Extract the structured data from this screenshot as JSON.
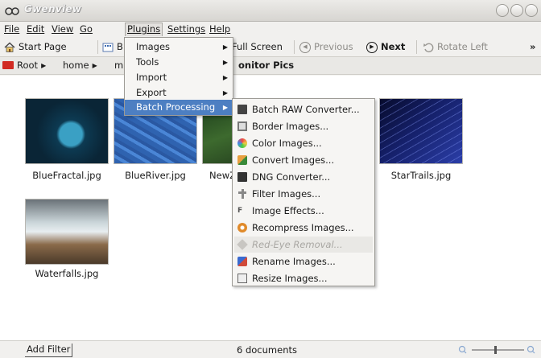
{
  "window": {
    "title": "Gwenview"
  },
  "menubar": {
    "items": [
      {
        "label": "File"
      },
      {
        "label": "Edit"
      },
      {
        "label": "View"
      },
      {
        "label": "Go"
      },
      {
        "label": "Plugins"
      },
      {
        "label": "Settings"
      },
      {
        "label": "Help"
      }
    ]
  },
  "toolbar": {
    "start_page": "Start Page",
    "browse_partial": "B",
    "full_screen": "Full Screen",
    "previous": "Previous",
    "next": "Next",
    "rotate_left": "Rotate Left",
    "overflow": "»"
  },
  "pathbar": {
    "crumbs": [
      "Root",
      "home",
      "m"
    ],
    "folder_title": "onitor Pics"
  },
  "thumbnails": [
    {
      "filename": "BlueFractal.jpg",
      "colors": [
        "#0a2536",
        "#1f6f8c",
        "#3aa0c4"
      ]
    },
    {
      "filename": "BlueRiver.jpg",
      "colors": [
        "#1f4a8a",
        "#3d78c8",
        "#6aa0e6"
      ]
    },
    {
      "filename": "NewZ",
      "colors": [
        "#1a3a1a",
        "#3d6a2e",
        "#2a4a22"
      ]
    },
    {
      "filename": "StarTrails.jpg",
      "colors": [
        "#0a0f3a",
        "#1d2a8a",
        "#3a4fc6"
      ]
    },
    {
      "filename": "Waterfalls.jpg",
      "colors": [
        "#5a6a72",
        "#c9d4d8",
        "#8a6a4a"
      ]
    }
  ],
  "plugins_menu": {
    "items": [
      {
        "label": "Images",
        "submenu": true
      },
      {
        "label": "Tools",
        "submenu": true
      },
      {
        "label": "Import",
        "submenu": true
      },
      {
        "label": "Export",
        "submenu": true
      },
      {
        "label": "Batch Processing",
        "submenu": true,
        "active": true
      }
    ]
  },
  "batch_menu": {
    "items": [
      {
        "label": "Batch RAW Converter...",
        "icon": "raw-converter-icon"
      },
      {
        "label": "Border Images...",
        "icon": "border-icon"
      },
      {
        "label": "Color Images...",
        "icon": "color-icon"
      },
      {
        "label": "Convert Images...",
        "icon": "convert-icon"
      },
      {
        "label": "DNG Converter...",
        "icon": "dng-icon"
      },
      {
        "label": "Filter Images...",
        "icon": "filter-icon"
      },
      {
        "label": "Image Effects...",
        "icon": "effects-icon"
      },
      {
        "label": "Recompress Images...",
        "icon": "recompress-icon"
      },
      {
        "label": "Red-Eye Removal...",
        "icon": "red-eye-icon",
        "disabled": true
      },
      {
        "label": "Rename Images...",
        "icon": "rename-icon"
      },
      {
        "label": "Resize Images...",
        "icon": "resize-icon"
      }
    ]
  },
  "statusbar": {
    "add_filter": "Add Filter",
    "document_count": "6 documents"
  },
  "colors": {
    "accent": "#4d7fc2",
    "folder_red": "#d12a22"
  }
}
